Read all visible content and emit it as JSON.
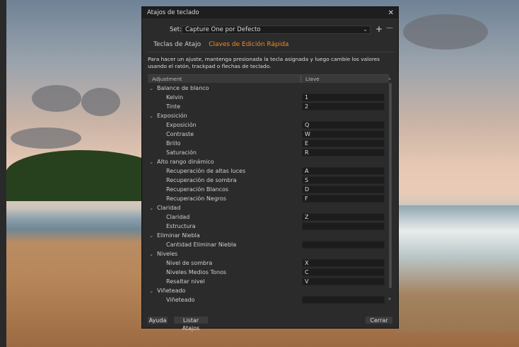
{
  "dialog": {
    "title": "Atajos de teclado",
    "close_glyph": "✕",
    "set_label": "Set:",
    "set_value": "Capture One por Defecto",
    "add_glyph": "+",
    "remove_glyph": "—",
    "tabs": [
      {
        "label": "Teclas de Atajo",
        "active": false
      },
      {
        "label": "Claves de Edición Rápida",
        "active": true
      }
    ],
    "description": "Para hacer un ajuste, mantenga presionada la tecla asignada y luego cambie los valores usando el ratón, trackpad o flechas de teclado.",
    "columns": [
      "Adjustment",
      "Llave"
    ],
    "rows": [
      {
        "type": "group",
        "name": "Balance de blanco"
      },
      {
        "type": "item",
        "name": "Kelvin",
        "key": "1"
      },
      {
        "type": "item",
        "name": "Tinte",
        "key": "2"
      },
      {
        "type": "group",
        "name": "Exposición"
      },
      {
        "type": "item",
        "name": "Exposición",
        "key": "Q"
      },
      {
        "type": "item",
        "name": "Contraste",
        "key": "W"
      },
      {
        "type": "item",
        "name": "Brillo",
        "key": "E"
      },
      {
        "type": "item",
        "name": "Saturación",
        "key": "R"
      },
      {
        "type": "group",
        "name": "Alto rango dinámico"
      },
      {
        "type": "item",
        "name": "Recuperación de altas luces",
        "key": "A"
      },
      {
        "type": "item",
        "name": "Recuperación de sombra",
        "key": "S"
      },
      {
        "type": "item",
        "name": "Recuperación Blancos",
        "key": "D"
      },
      {
        "type": "item",
        "name": "Recuperación Negros",
        "key": "F"
      },
      {
        "type": "group",
        "name": "Claridad"
      },
      {
        "type": "item",
        "name": "Claridad",
        "key": "Z"
      },
      {
        "type": "item",
        "name": "Estructura",
        "key": ""
      },
      {
        "type": "group",
        "name": "Eliminar Niebla"
      },
      {
        "type": "item",
        "name": "Cantidad Eliminar Niebla",
        "key": ""
      },
      {
        "type": "group",
        "name": "Niveles"
      },
      {
        "type": "item",
        "name": "Nivel de sombra",
        "key": "X"
      },
      {
        "type": "item",
        "name": "Niveles Medios Tonos",
        "key": "C"
      },
      {
        "type": "item",
        "name": "Resaltar nivel",
        "key": "V"
      },
      {
        "type": "group",
        "name": "Viñeteado"
      },
      {
        "type": "item",
        "name": "Viñeteado",
        "key": ""
      }
    ],
    "buttons": {
      "help": "Ayuda",
      "list": "Listar Atajos",
      "close": "Cerrar"
    },
    "colors": {
      "accent": "#f08a2c",
      "panel": "#2b2b2b"
    }
  }
}
